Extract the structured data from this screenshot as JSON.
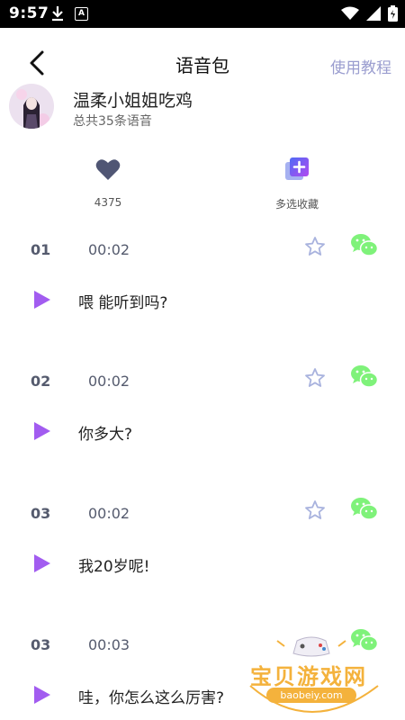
{
  "status_bar": {
    "time": "9:57",
    "badge": "A"
  },
  "header": {
    "title": "语音包",
    "tutorial_link": "使用教程"
  },
  "profile": {
    "name": "温柔小姐姐吃鸡",
    "count_text": "总共35条语音"
  },
  "actions": [
    {
      "icon": "heart-icon",
      "label": "4375"
    },
    {
      "icon": "multi-favorite-icon",
      "label": "多选收藏"
    }
  ],
  "voice_items": [
    {
      "number": "01",
      "duration": "00:02",
      "text": "喂 能听到吗?"
    },
    {
      "number": "02",
      "duration": "00:02",
      "text": "你多大?"
    },
    {
      "number": "03",
      "duration": "00:02",
      "text": "我20岁呢!"
    },
    {
      "number": "03",
      "duration": "00:03",
      "text": "哇，你怎么这么厉害?"
    }
  ],
  "watermark": {
    "text": "宝贝游戏网",
    "url": "baobeiy.com"
  },
  "colors": {
    "accent_purple": "#a25cf0",
    "tutorial_text": "#9a9dcf",
    "heart": "#505674",
    "star_outline": "#a9b3de",
    "wechat_green": "#7ff27a",
    "watermark_gold": "#f4b23c"
  }
}
